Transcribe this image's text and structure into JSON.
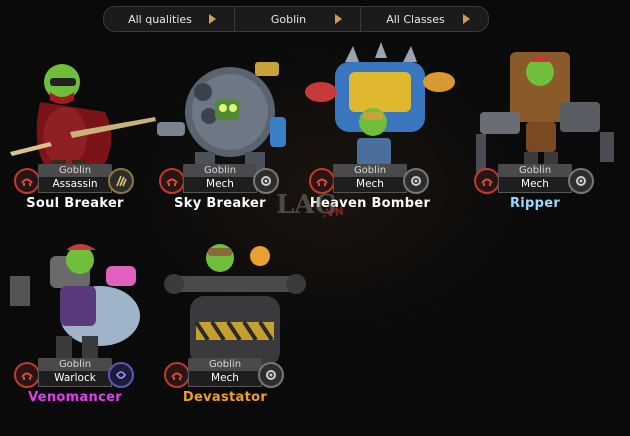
{
  "filters": {
    "quality": "All qualities",
    "race": "Goblin",
    "class": "All Classes"
  },
  "heroes": [
    {
      "name": "Soul Breaker",
      "race": "Goblin",
      "class": "Assassin",
      "name_color": "#ffffff",
      "class_icon": "claw-icon"
    },
    {
      "name": "Sky Breaker",
      "race": "Goblin",
      "class": "Mech",
      "name_color": "#ffffff",
      "class_icon": "gear-icon"
    },
    {
      "name": "Heaven Bomber",
      "race": "Goblin",
      "class": "Mech",
      "name_color": "#ffffff",
      "class_icon": "gear-icon"
    },
    {
      "name": "Ripper",
      "race": "Goblin",
      "class": "Mech",
      "name_color": "#9ad8ff",
      "class_icon": "gear-icon"
    },
    {
      "name": "Venomancer",
      "race": "Goblin",
      "class": "Warlock",
      "name_color": "#e63cf0",
      "class_icon": "warlock-icon"
    },
    {
      "name": "Devastator",
      "race": "Goblin",
      "class": "Mech",
      "name_color": "#f0a020",
      "class_icon": "gear-icon"
    }
  ],
  "watermark": {
    "main": "LAG",
    "sub": ".VN"
  },
  "colors": {
    "accent": "#caa24a",
    "faction_ring": "#c23a2a"
  }
}
